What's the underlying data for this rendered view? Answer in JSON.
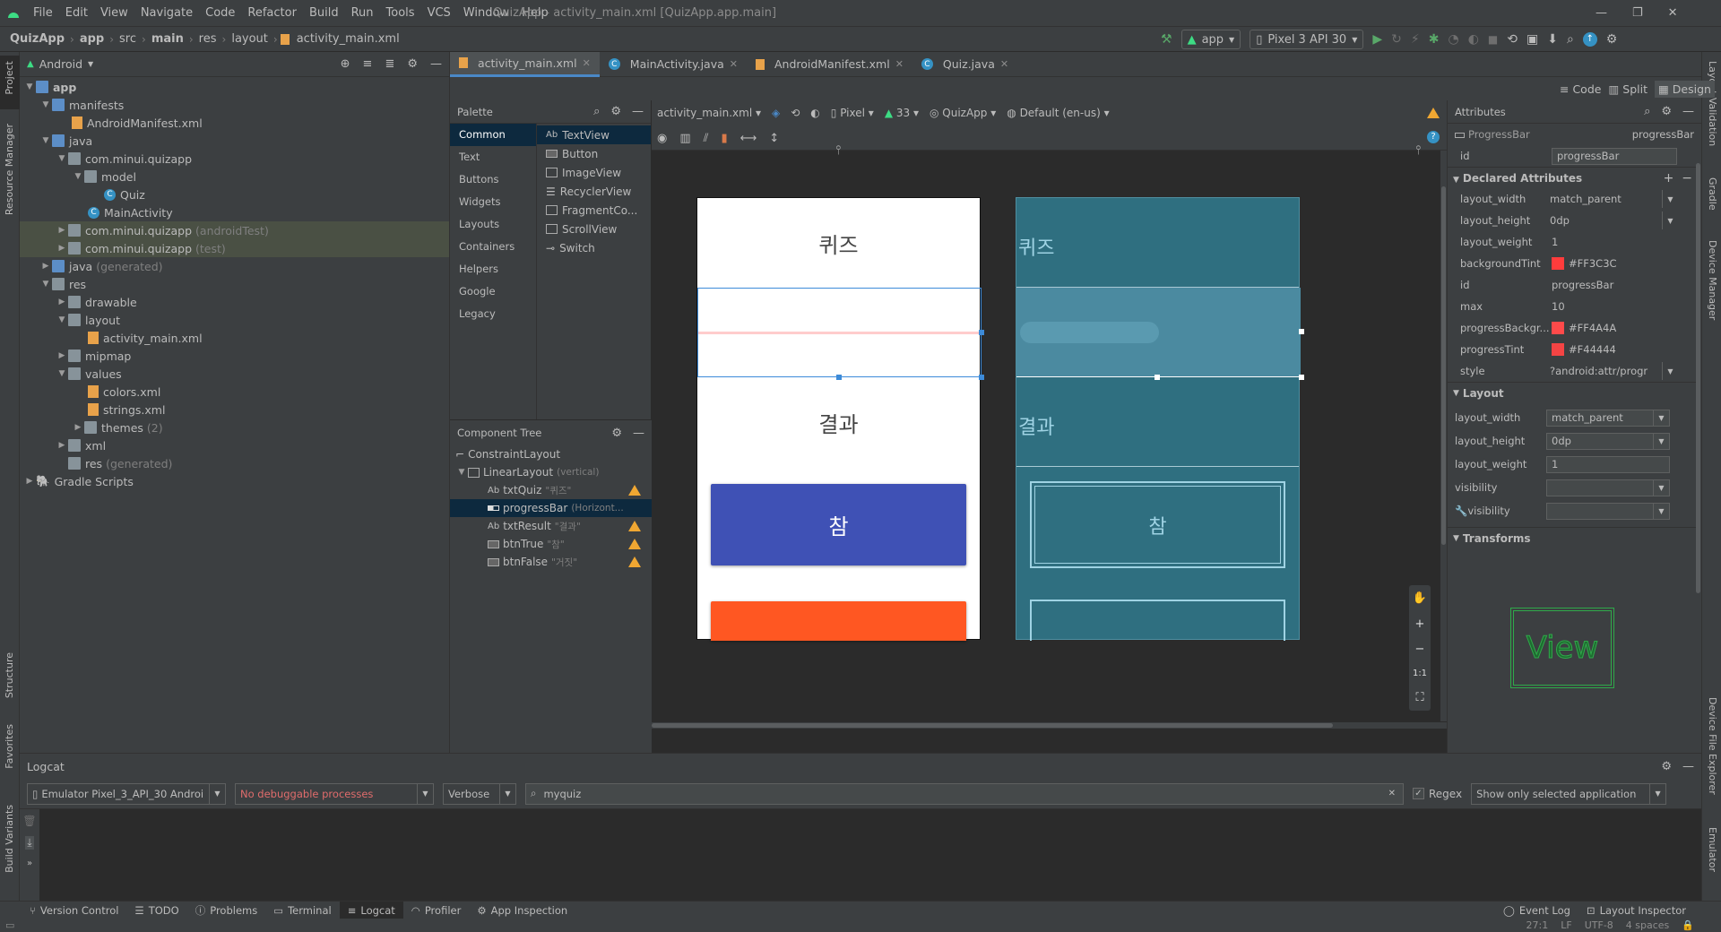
{
  "menubar": {
    "items": [
      "File",
      "Edit",
      "View",
      "Navigate",
      "Code",
      "Refactor",
      "Build",
      "Run",
      "Tools",
      "VCS",
      "Window",
      "Help"
    ],
    "window_title": "QuizApp - activity_main.xml [QuizApp.app.main]"
  },
  "breadcrumb": [
    "QuizApp",
    "app",
    "src",
    "main",
    "res",
    "layout",
    "activity_main.xml"
  ],
  "toolbar": {
    "run_config": "app",
    "device": "Pixel 3 API 30"
  },
  "left_strip": [
    "Project",
    "Resource Manager",
    "Structure",
    "Favorites",
    "Build Variants"
  ],
  "right_strip": [
    "Layout Validation",
    "Gradle",
    "Device Manager",
    "Device File Explorer",
    "Emulator"
  ],
  "project": {
    "view_mode": "Android",
    "tree": [
      {
        "label": "app",
        "extra": ""
      },
      {
        "label": "manifests",
        "extra": ""
      },
      {
        "label": "AndroidManifest.xml",
        "extra": ""
      },
      {
        "label": "java",
        "extra": ""
      },
      {
        "label": "com.minui.quizapp",
        "extra": ""
      },
      {
        "label": "model",
        "extra": ""
      },
      {
        "label": "Quiz",
        "extra": ""
      },
      {
        "label": "MainActivity",
        "extra": ""
      },
      {
        "label": "com.minui.quizapp",
        "extra": "(androidTest)"
      },
      {
        "label": "com.minui.quizapp",
        "extra": "(test)"
      },
      {
        "label": "java",
        "extra": "(generated)"
      },
      {
        "label": "res",
        "extra": ""
      },
      {
        "label": "drawable",
        "extra": ""
      },
      {
        "label": "layout",
        "extra": ""
      },
      {
        "label": "activity_main.xml",
        "extra": ""
      },
      {
        "label": "mipmap",
        "extra": ""
      },
      {
        "label": "values",
        "extra": ""
      },
      {
        "label": "colors.xml",
        "extra": ""
      },
      {
        "label": "strings.xml",
        "extra": ""
      },
      {
        "label": "themes",
        "extra": "(2)"
      },
      {
        "label": "xml",
        "extra": ""
      },
      {
        "label": "res",
        "extra": "(generated)"
      },
      {
        "label": "Gradle Scripts",
        "extra": ""
      }
    ]
  },
  "editor_tabs": [
    "activity_main.xml",
    "MainActivity.java",
    "AndroidManifest.xml",
    "Quiz.java"
  ],
  "view_switch": [
    "Code",
    "Split",
    "Design"
  ],
  "palette": {
    "title": "Palette",
    "categories": [
      "Common",
      "Text",
      "Buttons",
      "Widgets",
      "Layouts",
      "Containers",
      "Helpers",
      "Google",
      "Legacy"
    ],
    "items": [
      {
        "icon": "Ab",
        "label": "TextView"
      },
      {
        "icon": "",
        "label": "Button"
      },
      {
        "icon": "",
        "label": "ImageView"
      },
      {
        "icon": "",
        "label": "RecyclerView"
      },
      {
        "icon": "",
        "label": "FragmentCo..."
      },
      {
        "icon": "",
        "label": "ScrollView"
      },
      {
        "icon": "",
        "label": "Switch"
      }
    ]
  },
  "component_tree": {
    "title": "Component Tree",
    "nodes": [
      {
        "label": "ConstraintLayout",
        "sub": ""
      },
      {
        "label": "LinearLayout",
        "sub": "(vertical)"
      },
      {
        "label": "txtQuiz",
        "sub": "\"퀴즈\""
      },
      {
        "label": "progressBar",
        "sub": "(Horizont..."
      },
      {
        "label": "txtResult",
        "sub": "\"결과\""
      },
      {
        "label": "btnTrue",
        "sub": "\"참\""
      },
      {
        "label": "btnFalse",
        "sub": "\"거짓\""
      }
    ]
  },
  "design_toolbar": {
    "file": "activity_main.xml",
    "device": "Pixel",
    "api": "33",
    "theme": "QuizApp",
    "locale": "Default (en-us)"
  },
  "preview": {
    "quiz": "퀴즈",
    "result": "결과",
    "true_btn": "참",
    "true_color": "#3F51B5",
    "false_color": "#FF5722",
    "blueprint_color": "#2f6f80"
  },
  "attributes": {
    "title": "Attributes",
    "widget": "ProgressBar",
    "widget_id": "progressBar",
    "id_label": "id",
    "id_value": "progressBar",
    "declared_title": "Declared Attributes",
    "declared": [
      {
        "k": "layout_width",
        "v": "match_parent",
        "color": ""
      },
      {
        "k": "layout_height",
        "v": "0dp",
        "color": ""
      },
      {
        "k": "layout_weight",
        "v": "1",
        "color": ""
      },
      {
        "k": "backgroundTint",
        "v": "#FF3C3C",
        "color": "#FF3C3C"
      },
      {
        "k": "id",
        "v": "progressBar",
        "color": ""
      },
      {
        "k": "max",
        "v": "10",
        "color": ""
      },
      {
        "k": "progressBackgr...",
        "v": "#FF4A4A",
        "color": "#FF4A4A"
      },
      {
        "k": "progressTint",
        "v": "#F44444",
        "color": "#F44444"
      },
      {
        "k": "style",
        "v": "?android:attr/progr",
        "color": ""
      }
    ],
    "layout_title": "Layout",
    "layout": [
      {
        "k": "layout_width",
        "v": "match_parent"
      },
      {
        "k": "layout_height",
        "v": "0dp"
      },
      {
        "k": "layout_weight",
        "v": "1"
      },
      {
        "k": "visibility",
        "v": ""
      },
      {
        "k": "visibility",
        "v": ""
      }
    ],
    "transforms_title": "Transforms",
    "preview_text": "View"
  },
  "logcat": {
    "title": "Logcat",
    "device": "Emulator Pixel_3_API_30 Androi",
    "process": "No debuggable processes",
    "level": "Verbose",
    "search": "myquiz",
    "regex": "Regex",
    "filter": "Show only selected application"
  },
  "bottom_tabs": [
    "Version Control",
    "TODO",
    "Problems",
    "Terminal",
    "Logcat",
    "Profiler",
    "App Inspection"
  ],
  "bottom_right": [
    "Event Log",
    "Layout Inspector"
  ],
  "status": [
    "27:1",
    "LF",
    "UTF-8",
    "4 spaces"
  ]
}
